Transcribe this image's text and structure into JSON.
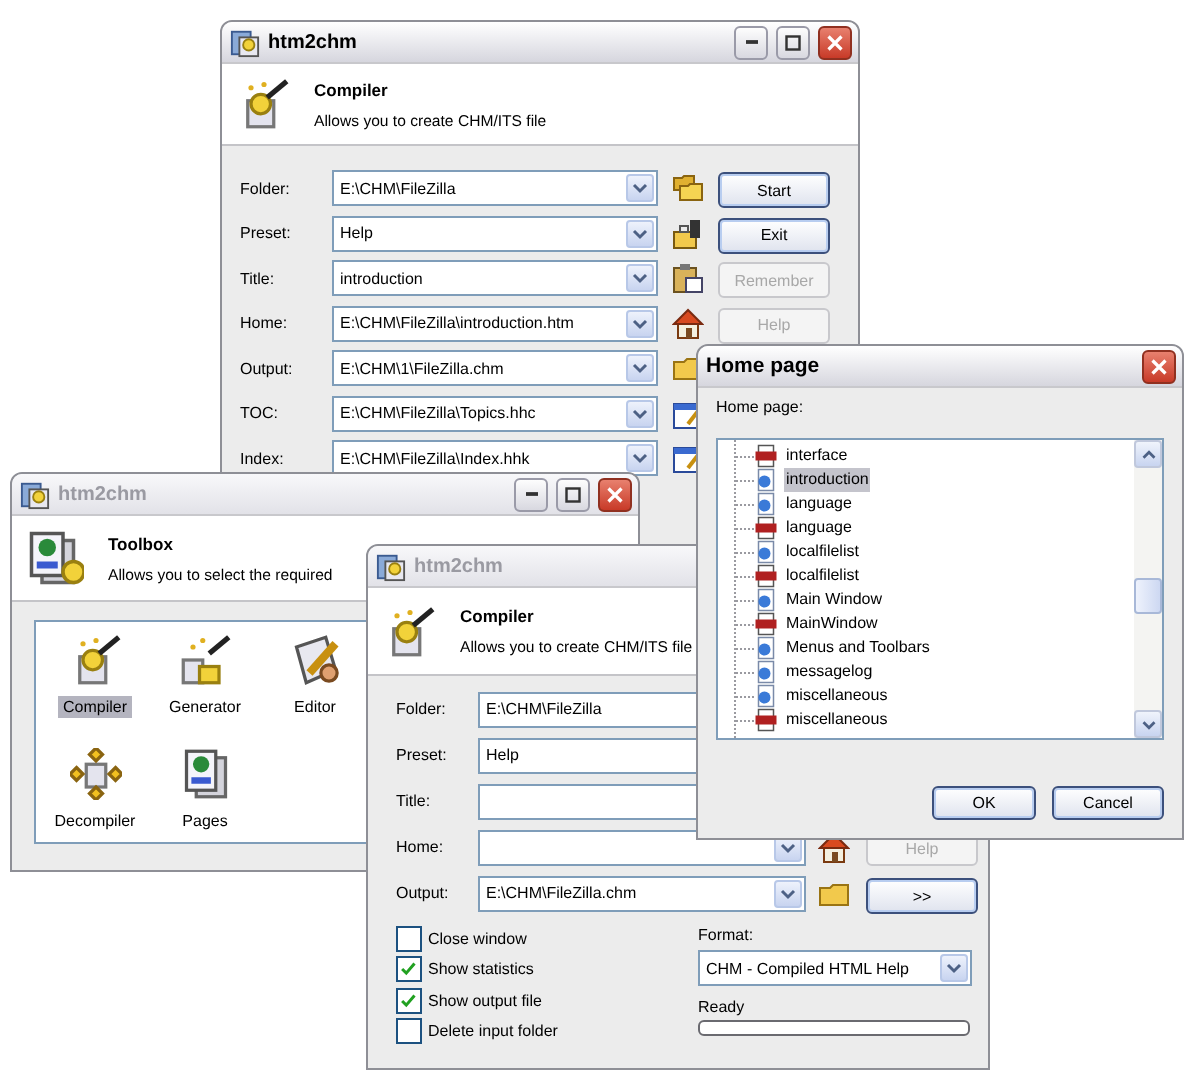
{
  "back_window": {
    "title": "htm2chm",
    "active": true,
    "heading": "Compiler",
    "description": "Allows you to create CHM/ITS file",
    "fields": [
      {
        "label": "Folder:",
        "value": "E:\\CHM\\FileZilla"
      },
      {
        "label": "Preset:",
        "value": "Help"
      },
      {
        "label": "Title:",
        "value": "introduction"
      },
      {
        "label": "Home:",
        "value": "E:\\CHM\\FileZilla\\introduction.htm"
      },
      {
        "label": "Output:",
        "value": "E:\\CHM\\1\\FileZilla.chm"
      },
      {
        "label": "TOC:",
        "value": "E:\\CHM\\FileZilla\\Topics.hhc"
      },
      {
        "label": "Index:",
        "value": "E:\\CHM\\FileZilla\\Index.hhk"
      }
    ],
    "buttons": [
      {
        "label": "Start",
        "disabled": false
      },
      {
        "label": "Exit",
        "disabled": false
      },
      {
        "label": "Remember",
        "disabled": true
      },
      {
        "label": "Help",
        "disabled": true
      }
    ]
  },
  "toolbox_window": {
    "title": "htm2chm",
    "active": false,
    "heading": "Toolbox",
    "description": "Allows you to select the required",
    "tools": [
      {
        "label": "Compiler",
        "selected": true
      },
      {
        "label": "Generator",
        "selected": false
      },
      {
        "label": "Editor",
        "selected": false
      },
      {
        "label": "Decompiler",
        "selected": false
      },
      {
        "label": "Pages",
        "selected": false
      }
    ]
  },
  "front_window": {
    "title": "htm2chm",
    "active": false,
    "heading": "Compiler",
    "description": "Allows you to create CHM/ITS file",
    "fields": [
      {
        "label": "Folder:",
        "value": "E:\\CHM\\FileZilla"
      },
      {
        "label": "Preset:",
        "value": "Help"
      },
      {
        "label": "Title:"
      },
      {
        "label": "Home:"
      },
      {
        "label": "Output:",
        "value": "E:\\CHM\\FileZilla.chm"
      }
    ],
    "buttons": [
      {
        "label": "Help",
        "disabled": true
      },
      {
        "label": ">>",
        "disabled": false
      }
    ],
    "options": [
      {
        "label": "Close window",
        "checked": false
      },
      {
        "label": "Show statistics",
        "checked": true
      },
      {
        "label": "Show output file",
        "checked": true
      },
      {
        "label": "Delete input folder",
        "checked": false
      }
    ],
    "format_label": "Format:",
    "format": "CHM - Compiled HTML Help",
    "status": "Ready",
    "progress": {
      "level": 0
    }
  },
  "home_page_dialog": {
    "title": "Home page",
    "active": true,
    "label": "Home page:",
    "items": [
      {
        "text": "interface",
        "kind": "image",
        "selected": false
      },
      {
        "text": "introduction",
        "kind": "web",
        "selected": true
      },
      {
        "text": "language",
        "kind": "web",
        "selected": false
      },
      {
        "text": "language",
        "kind": "image",
        "selected": false
      },
      {
        "text": "localfilelist",
        "kind": "web",
        "selected": false
      },
      {
        "text": "localfilelist",
        "kind": "image",
        "selected": false
      },
      {
        "text": "Main Window",
        "kind": "web",
        "selected": false
      },
      {
        "text": "MainWindow",
        "kind": "image",
        "selected": false
      },
      {
        "text": "Menus and Toolbars",
        "kind": "web",
        "selected": false
      },
      {
        "text": "messagelog",
        "kind": "web",
        "selected": false
      },
      {
        "text": "miscellaneous",
        "kind": "web",
        "selected": false
      },
      {
        "text": "miscellaneous",
        "kind": "image",
        "selected": false
      }
    ],
    "buttons": [
      {
        "label": "OK"
      },
      {
        "label": "Cancel"
      }
    ]
  }
}
